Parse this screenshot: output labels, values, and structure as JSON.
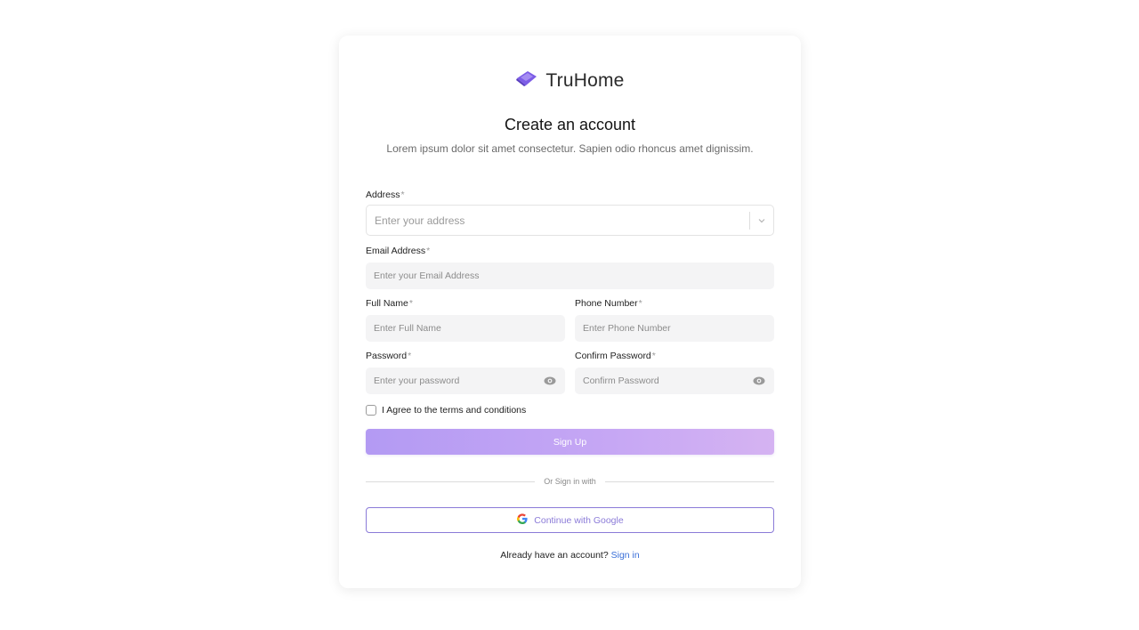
{
  "brand": {
    "name": "TruHome"
  },
  "header": {
    "title": "Create an account",
    "subtitle": "Lorem ipsum dolor sit amet consectetur. Sapien odio rhoncus amet dignissim."
  },
  "form": {
    "required_marker": "*",
    "address": {
      "label": "Address",
      "placeholder": "Enter your address"
    },
    "email": {
      "label": "Email Address",
      "placeholder": "Enter your Email Address"
    },
    "full_name": {
      "label": "Full Name",
      "placeholder": "Enter Full Name"
    },
    "phone": {
      "label": "Phone Number",
      "placeholder": "Enter Phone Number"
    },
    "password": {
      "label": "Password",
      "placeholder": "Enter your password"
    },
    "confirm_password": {
      "label": "Confirm Password",
      "placeholder": "Confirm Password"
    },
    "terms": {
      "label": "I Agree to the terms and conditions",
      "checked": false
    },
    "submit_label": "Sign Up"
  },
  "alt_signin": {
    "divider_text": "Or Sign in with",
    "google_label": "Continue with Google"
  },
  "footer": {
    "prompt": "Already have an account? ",
    "link": "Sign in"
  },
  "colors": {
    "accent": "#8b7bd8",
    "button_gradient_start": "#b39af3",
    "button_gradient_end": "#d5b3f2",
    "link": "#3a6fd8"
  },
  "icons": {
    "logo": "truhome-logo-icon",
    "select": "chevron-down-icon",
    "reveal": "eye-icon",
    "google": "google-icon"
  }
}
